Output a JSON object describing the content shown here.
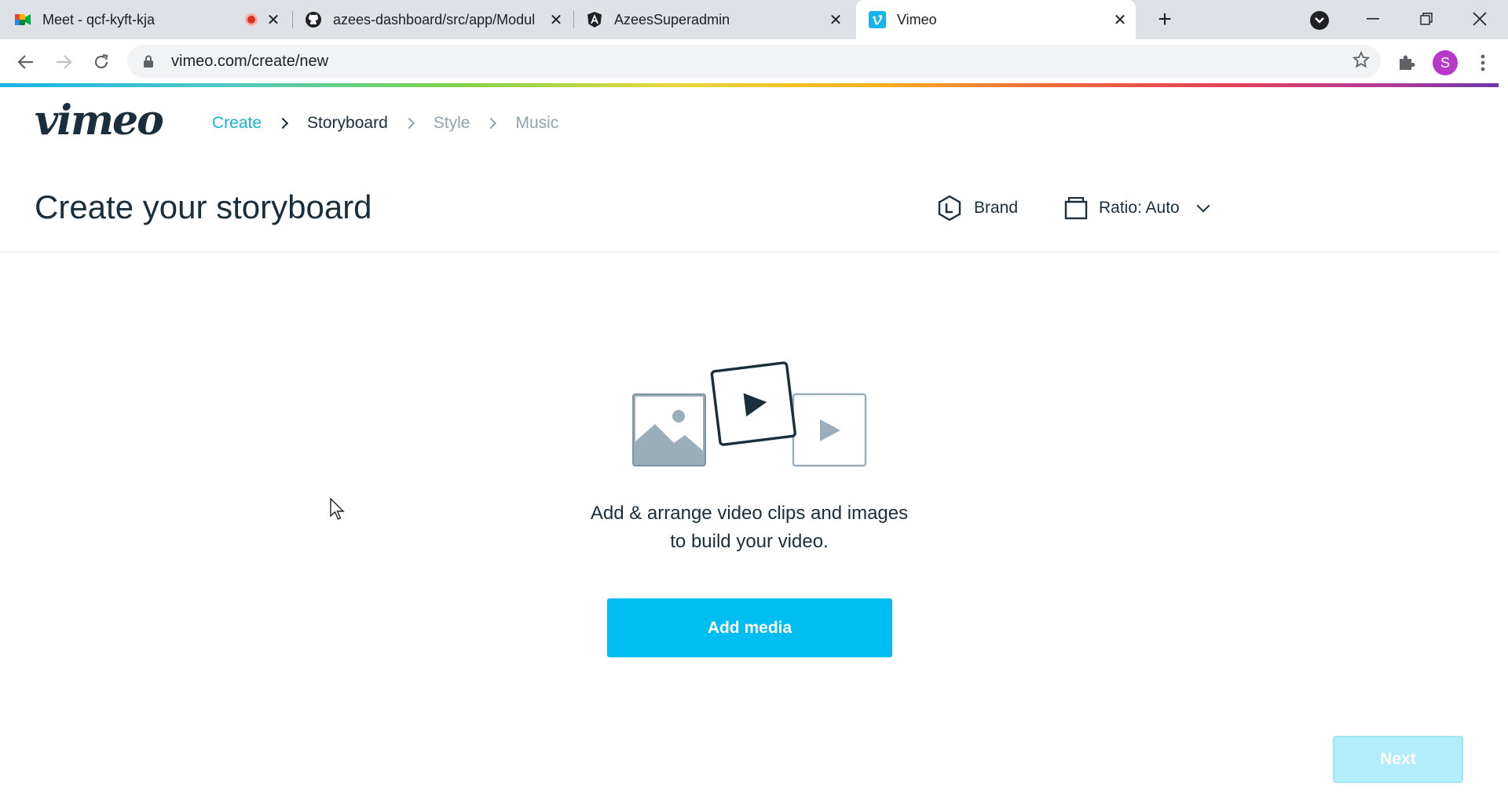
{
  "browser": {
    "tabs": [
      {
        "title": "Meet - qcf-kyft-kja",
        "icon": "google-meet-icon",
        "recording": true,
        "active": false
      },
      {
        "title": "azees-dashboard/src/app/Modul",
        "icon": "github-icon",
        "active": false
      },
      {
        "title": "AzeesSuperadmin",
        "icon": "angular-icon",
        "active": false
      },
      {
        "title": "Vimeo",
        "icon": "vimeo-icon",
        "active": true
      }
    ],
    "url": "vimeo.com/create/new",
    "profile_initial": "S",
    "colors": {
      "profile": "#b63ac7",
      "tabstrip": "#dee1e6"
    }
  },
  "vimeo": {
    "logo_text": "vimeo",
    "steps": [
      {
        "label": "Create",
        "state": "done"
      },
      {
        "label": "Storyboard",
        "state": "current"
      },
      {
        "label": "Style",
        "state": "upcoming"
      },
      {
        "label": "Music",
        "state": "upcoming"
      }
    ],
    "page_title": "Create your storyboard",
    "brand_label": "Brand",
    "ratio_label": "Ratio: Auto",
    "empty_state": {
      "line1": "Add & arrange video clips and images",
      "line2": "to build your video."
    },
    "add_media_label": "Add media",
    "next_label": "Next",
    "next_enabled": false,
    "colors": {
      "accent": "#00bdf2",
      "text": "#1a2e3b",
      "muted": "#8fa3ad",
      "done_step": "#17b4d6"
    }
  }
}
